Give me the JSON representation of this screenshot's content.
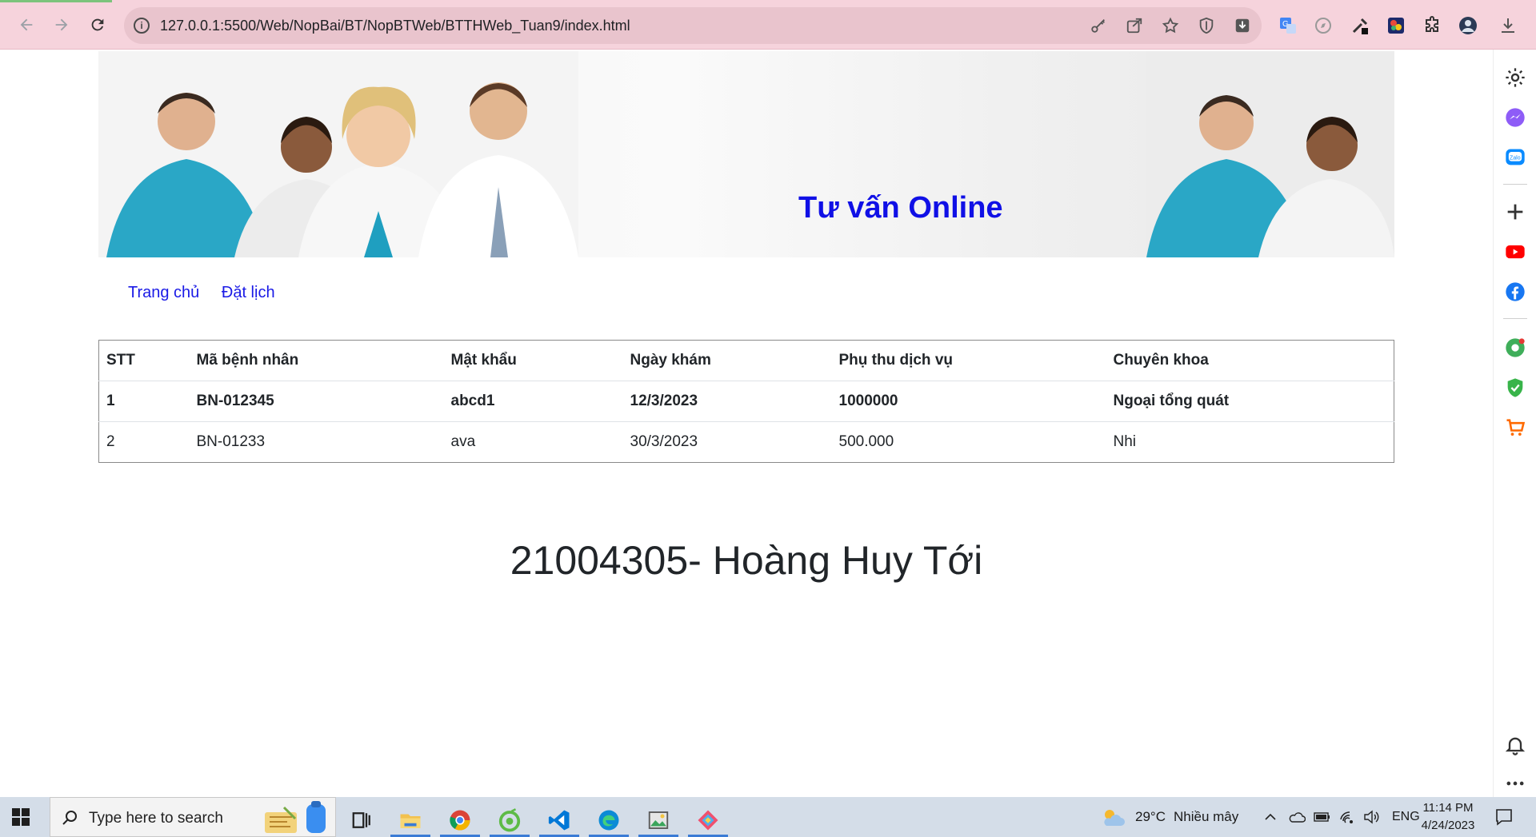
{
  "browser": {
    "url": "127.0.0.1:5500/Web/NopBai/BT/NopBTWeb/BTTHWeb_Tuan9/index.html"
  },
  "page": {
    "banner_title": "Tư vấn Online",
    "menu": [
      {
        "label": "Trang chủ"
      },
      {
        "label": "Đặt lịch"
      }
    ],
    "table": {
      "headers": [
        "STT",
        "Mã bệnh nhân",
        "Mật khẩu",
        "Ngày khám",
        "Phụ thu dịch vụ",
        "Chuyên khoa"
      ],
      "rows": [
        [
          "1",
          "BN-012345",
          "abcd1",
          "12/3/2023",
          "1000000",
          "Ngoại tổng quát"
        ],
        [
          "2",
          "BN-01233",
          "ava",
          "30/3/2023",
          "500.000",
          "Nhi"
        ]
      ]
    },
    "student_label": "21004305- Hoàng Huy Tới"
  },
  "taskbar": {
    "search_placeholder": "Type here to search",
    "weather_temp": "29°C",
    "weather_text": "Nhiều mây",
    "language": "ENG",
    "time": "11:14 PM",
    "date": "4/24/2023"
  },
  "colors": {
    "chrome_bg": "#f6d3dc",
    "omnibox_bg": "#e9c4cd",
    "banner_title": "#1010e6",
    "link": "#1a1ae6",
    "taskbar_bg": "#d4dde8"
  }
}
